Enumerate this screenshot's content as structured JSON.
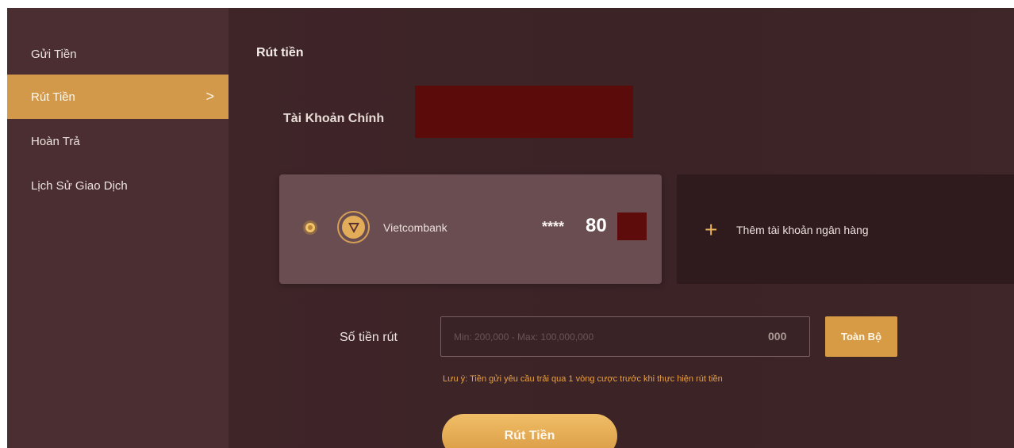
{
  "sidebar": {
    "items": [
      {
        "label": "Gửi Tiền"
      },
      {
        "label": "Rút Tiền"
      },
      {
        "label": "Hoàn Trả"
      },
      {
        "label": "Lịch Sử Giao Dịch"
      }
    ],
    "active_chevron": ">"
  },
  "page": {
    "title": "Rút tiền"
  },
  "account": {
    "label": "Tài Khoản Chính"
  },
  "bank_card": {
    "bank_name": "Vietcombank",
    "masked_prefix": "****",
    "last_digits": "80"
  },
  "add_bank": {
    "plus": "+",
    "label": "Thêm tài khoản ngân hàng"
  },
  "withdraw": {
    "label": "Số tiền rút",
    "placeholder": "Min: 200,000 - Max: 100,000,000",
    "suffix": "000",
    "all_button": "Toàn Bộ",
    "note": "Lưu ý: Tiền gửi yêu cầu trải qua 1 vòng cược trước khi thực hiện rút tiền",
    "submit": "Rút Tiền"
  },
  "colors": {
    "accent": "#d89b45",
    "sidebar_bg": "#4b2e31",
    "main_bg": "#3e2629",
    "redaction": "#5d0b0b"
  },
  "icons": {
    "active_item": "chevron-right-icon",
    "bank": "vietcombank-logo-icon",
    "add": "plus-icon",
    "selection": "radio-selected-icon"
  }
}
